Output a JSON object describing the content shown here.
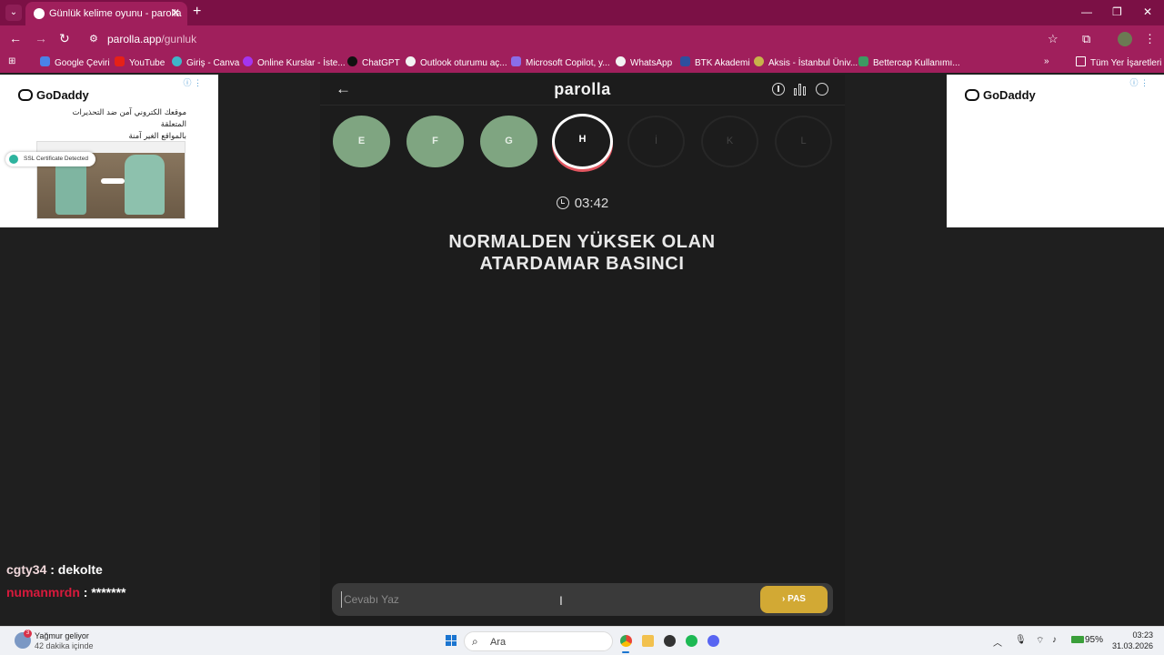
{
  "browser": {
    "tab_title": "Günlük kelime oyunu - parolla",
    "close": "✕",
    "new_tab": "+",
    "url_domain": "parolla.app",
    "url_path": "/gunluk",
    "bookmarks": [
      {
        "label": "Google Çeviri",
        "color": "#4a83e8"
      },
      {
        "label": "YouTube",
        "color": "#e62117"
      },
      {
        "label": "Giriş - Canva",
        "color": "#3fb6c9"
      },
      {
        "label": "Online Kurslar - İste...",
        "color": "#a435f0"
      },
      {
        "label": "ChatGPT",
        "color": "#111111"
      },
      {
        "label": "Outlook oturumu aç...",
        "color": "#f3f3f3"
      },
      {
        "label": "Microsoft Copilot, y...",
        "color": "#8a6ee8"
      },
      {
        "label": "WhatsApp",
        "color": "#f3f3f3"
      },
      {
        "label": "BTK Akademi",
        "color": "#2d4f9e"
      },
      {
        "label": "Aksis - İstanbul Üniv...",
        "color": "#c8b34a"
      },
      {
        "label": "Bettercap Kullanımı...",
        "color": "#3d9a62"
      }
    ],
    "overflow": "»",
    "all_bookmarks": "Tüm Yer İşaretleri"
  },
  "ads": {
    "brand": "GoDaddy",
    "left_text_line1": "موقعك الكتروني آمن ضد التحذيرات المتعلقة",
    "left_text_line2": "بالمواقع الغير آمنة",
    "ssl_badge": "SSL Certificate Detected",
    "info": "ⓘ ⋮"
  },
  "app": {
    "logo": "parolla",
    "letters": [
      {
        "letter": "E",
        "state": "done"
      },
      {
        "letter": "F",
        "state": "done"
      },
      {
        "letter": "G",
        "state": "done"
      },
      {
        "letter": "H",
        "state": "active"
      },
      {
        "letter": "İ",
        "state": "pending"
      },
      {
        "letter": "K",
        "state": "pending"
      },
      {
        "letter": "L",
        "state": "pending"
      }
    ],
    "timer": "03:42",
    "question_line1": "NORMALDEN YÜKSEK OLAN",
    "question_line2": "ATARDAMAR BASINCI",
    "answer_placeholder": "Cevabı Yaz",
    "pass_label": "PAS"
  },
  "chat": [
    {
      "user": "cgty34",
      "message": " : dekolte"
    },
    {
      "user": "numanmrdn",
      "message": " : *******"
    }
  ],
  "taskbar": {
    "weather_title": "Yağmur geliyor",
    "weather_sub": "42 dakika içinde",
    "weather_badge": "3",
    "search": "Ara",
    "battery": "95%",
    "time": "03:23",
    "date": "31.03.2026"
  }
}
